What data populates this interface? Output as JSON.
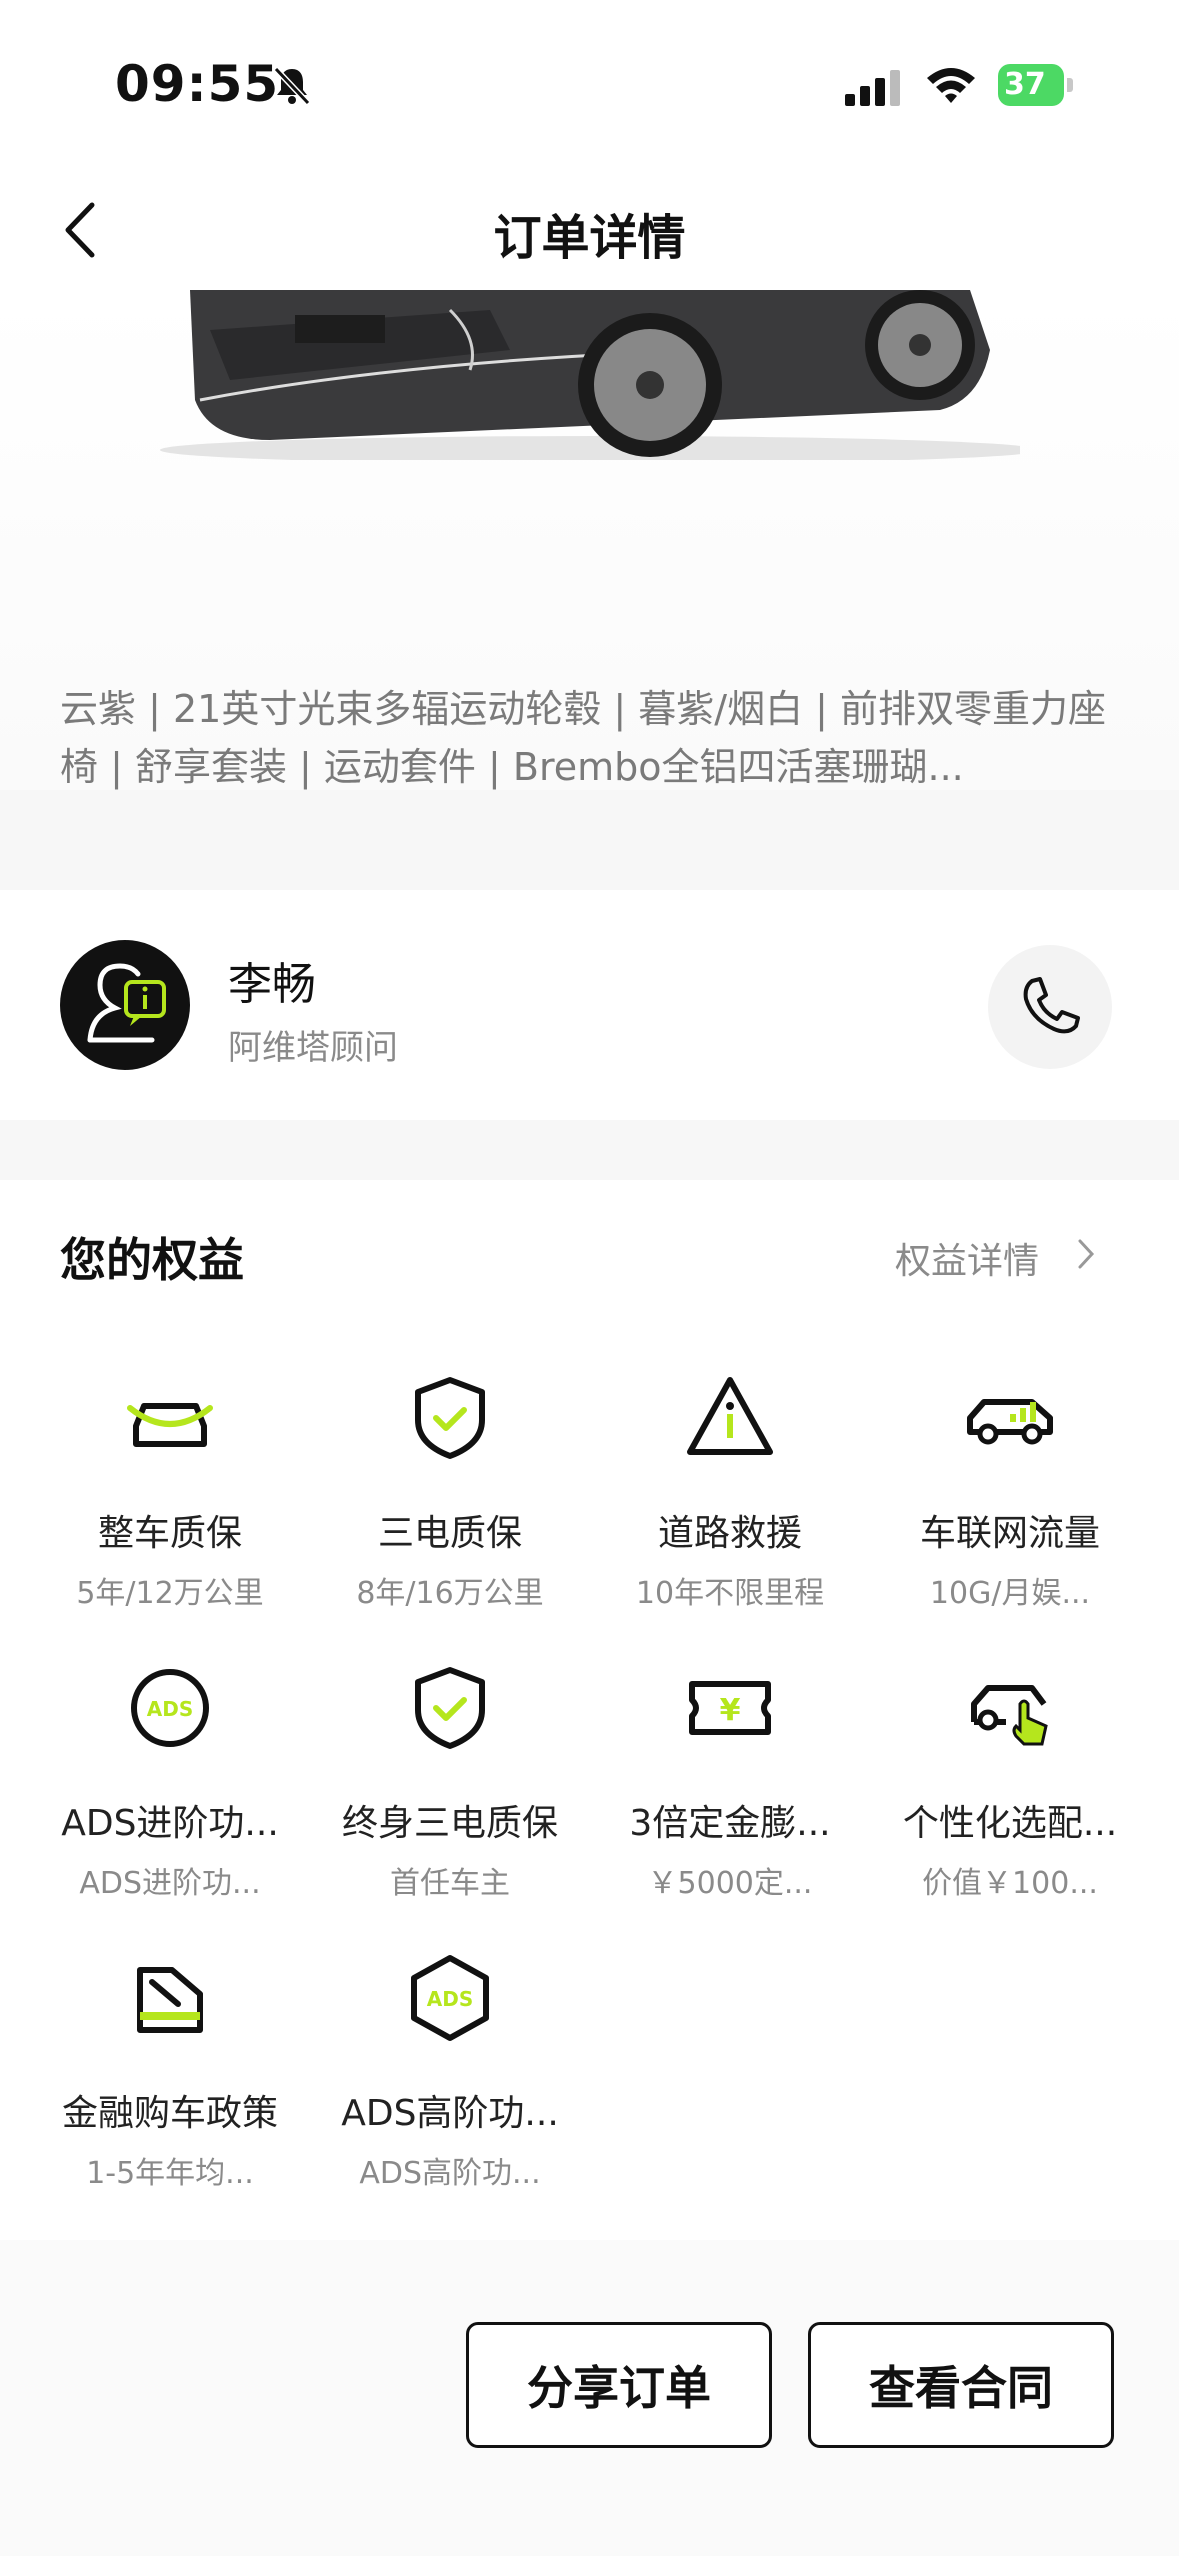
{
  "status_bar": {
    "time": "09:55",
    "battery": "37"
  },
  "nav": {
    "title": "订单详情"
  },
  "order": {
    "config_text": "云紫 | 21英寸光束多辐运动轮毂 | 暮紫/烟白 | 前排双零重力座椅 | 舒享套装 | 运动套件 | Brembo全铝四活塞珊瑚..."
  },
  "advisor": {
    "name": "李畅",
    "role": "阿维塔顾问"
  },
  "benefits": {
    "title": "您的权益",
    "detail_link": "权益详情",
    "items": [
      {
        "label": "整车质保",
        "sub": "5年/12万公里",
        "icon": "car-front-icon"
      },
      {
        "label": "三电质保",
        "sub": "8年/16万公里",
        "icon": "shield-check-icon"
      },
      {
        "label": "道路救援",
        "sub": "10年不限里程",
        "icon": "warning-triangle-icon"
      },
      {
        "label": "车联网流量",
        "sub": "10G/月娱...",
        "icon": "car-signal-icon"
      },
      {
        "label": "ADS进阶功...",
        "sub": "ADS进阶功...",
        "icon": "ads-circle-icon"
      },
      {
        "label": "终身三电质保",
        "sub": "首任车主",
        "icon": "shield-check-icon"
      },
      {
        "label": "3倍定金膨...",
        "sub": "￥5000定...",
        "icon": "ticket-yuan-icon"
      },
      {
        "label": "个性化选配...",
        "sub": "价值￥100...",
        "icon": "car-tap-icon"
      },
      {
        "label": "金融购车政策",
        "sub": "1-5年年均...",
        "icon": "hand-card-icon"
      },
      {
        "label": "ADS高阶功...",
        "sub": "ADS高阶功...",
        "icon": "ads-hexagon-icon"
      }
    ]
  },
  "actions": {
    "share": "分享订单",
    "contract": "查看合同"
  },
  "colors": {
    "accent": "#b5e61d",
    "text": "#111111",
    "muted": "#8a8a8a"
  }
}
